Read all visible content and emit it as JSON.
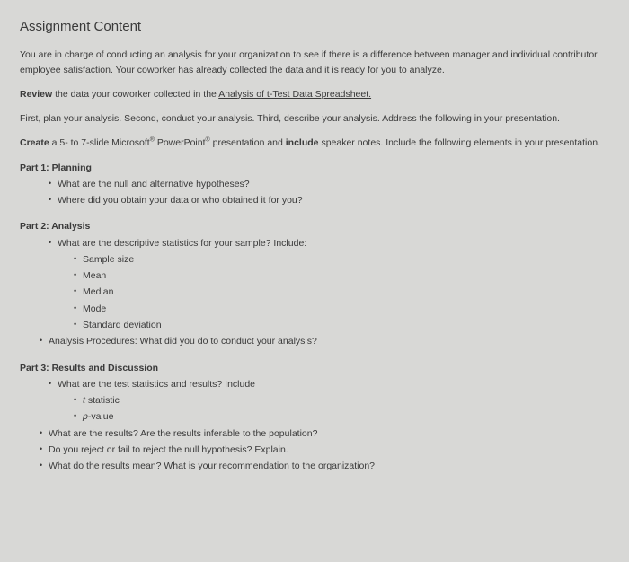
{
  "title": "Assignment Content",
  "intro": "You are in charge of conducting an analysis for your organization to see if there is a difference between manager and individual contributor employee satisfaction. Your coworker has already collected the data and it is ready for you to analyze.",
  "review_prefix": "Review",
  "review_text": " the data your coworker collected in the ",
  "review_link": "Analysis of t-Test Data Spreadsheet.",
  "plan": "First, plan your analysis. Second, conduct your analysis. Third, describe your analysis. Address the following in your presentation.",
  "create_prefix": "Create",
  "create_mid1": " a 5- to 7-slide Microsoft",
  "create_reg1": "®",
  "create_mid2": " PowerPoint",
  "create_reg2": "®",
  "create_mid3": " presentation and ",
  "create_include": "include",
  "create_end": " speaker notes. Include the following elements in your presentation.",
  "part1": {
    "title": "Part 1: Planning",
    "items": [
      "What are the null and alternative hypotheses?",
      "Where did you obtain your data or who obtained it for you?"
    ]
  },
  "part2": {
    "title": "Part 2: Analysis",
    "q1": "What are the descriptive statistics for your sample? Include:",
    "sub": [
      "Sample size",
      "Mean",
      "Median",
      "Mode",
      "Standard deviation"
    ],
    "q2": "Analysis Procedures: What did you do to conduct your analysis?"
  },
  "part3": {
    "title": "Part 3: Results and Discussion",
    "q1": "What are the test statistics and results? Include",
    "sub": [
      "t statistic",
      "p-value"
    ],
    "rest": [
      "What are the results? Are the results inferable to the population?",
      "Do you reject or fail to reject the null hypothesis? Explain.",
      "What do the results mean? What is your recommendation to the organization?"
    ]
  }
}
